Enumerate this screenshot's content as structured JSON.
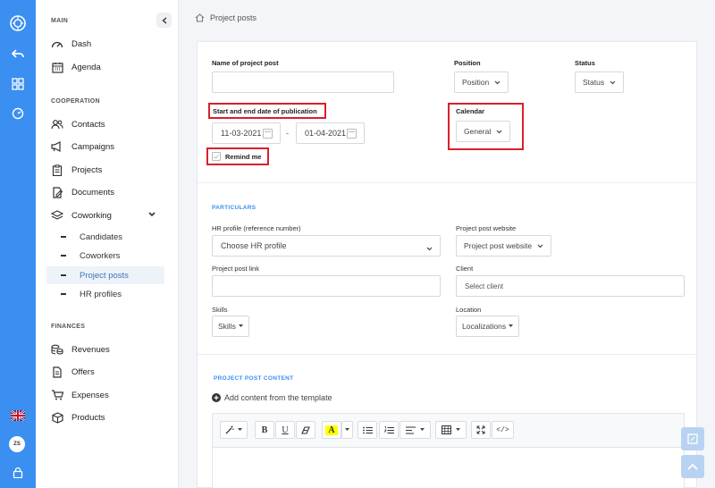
{
  "sidebar": {
    "main_title": "MAIN",
    "main_items": [
      {
        "label": "Dash",
        "icon": "gauge-icon"
      },
      {
        "label": "Agenda",
        "icon": "calendar-grid-icon"
      }
    ],
    "coop_title": "COOPERATION",
    "coop_items": [
      {
        "label": "Contacts",
        "icon": "users-icon"
      },
      {
        "label": "Campaigns",
        "icon": "megaphone-icon"
      },
      {
        "label": "Projects",
        "icon": "clipboard-icon"
      },
      {
        "label": "Documents",
        "icon": "document-edit-icon"
      },
      {
        "label": "Coworking",
        "icon": "layers-icon"
      }
    ],
    "coworking_sub": [
      "Candidates",
      "Coworkers",
      "Project posts",
      "HR profiles"
    ],
    "finances_title": "FINANCES",
    "finance_items": [
      {
        "label": "Revenues",
        "icon": "coins-icon"
      },
      {
        "label": "Offers",
        "icon": "document-icon"
      },
      {
        "label": "Expenses",
        "icon": "cart-icon"
      },
      {
        "label": "Products",
        "icon": "box-icon"
      }
    ]
  },
  "user": {
    "initials": "ZS"
  },
  "breadcrumb": {
    "label": "Project posts"
  },
  "form": {
    "name_label": "Name of project post",
    "position_label": "Position",
    "position_value": "Position",
    "status_label": "Status",
    "status_value": "Status",
    "dates_label": "Start and end date of publication",
    "start_date": "11-03-2021",
    "date_separator": "-",
    "end_date": "01-04-2021",
    "calendar_label": "Calendar",
    "calendar_value": "General",
    "remind_label": "Remind me"
  },
  "particulars": {
    "title": "PARTICULARS",
    "hr_label": "HR profile (reference number)",
    "hr_value": "Choose HR profile",
    "website_label": "Project post website",
    "website_value": "Project post website",
    "link_label": "Project post link",
    "client_label": "Client",
    "client_placeholder": "Select client",
    "skills_label": "Skills",
    "skills_value": "Skills",
    "location_label": "Location",
    "location_value": "Localizations"
  },
  "content": {
    "title": "PROJECT POST CONTENT",
    "add_template": "Add content from the template",
    "toolbar": {
      "bold": "B",
      "underline": "U",
      "highlight": "A",
      "code": "</>"
    }
  },
  "colors": {
    "accent": "#3a8ff0",
    "highlight_box": "#d9202b",
    "highlight_fill": "#ffff00"
  }
}
